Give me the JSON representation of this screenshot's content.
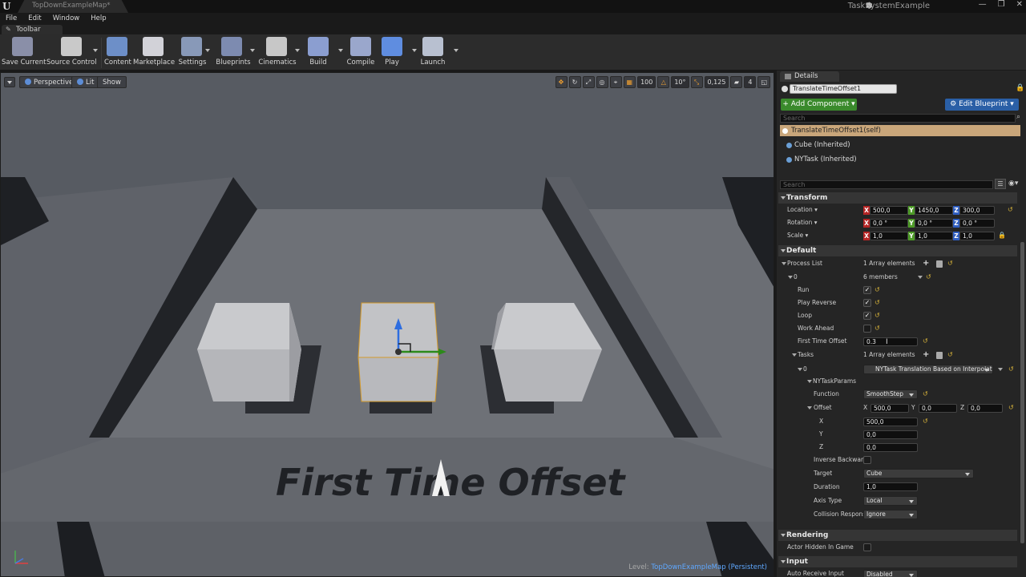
{
  "titlebar": {
    "doc_tab": "TopDownExampleMap*",
    "project": "TaskSystemExample",
    "controls": [
      "—",
      "❐",
      "✕"
    ]
  },
  "menu": [
    "File",
    "Edit",
    "Window",
    "Help"
  ],
  "toolbar_tab": "Toolbar",
  "toolbar": [
    {
      "label": "Save Current",
      "icon": "save-icon",
      "color": "#8a8fa8"
    },
    {
      "label": "Source Control",
      "icon": "source-control-icon",
      "color": "#c9c9c9"
    },
    {
      "label": "Content",
      "icon": "content-icon",
      "color": "#6d8fc8"
    },
    {
      "label": "Marketplace",
      "icon": "marketplace-icon",
      "color": "#d2d2d8"
    },
    {
      "label": "Settings",
      "icon": "settings-icon",
      "color": "#8899b8"
    },
    {
      "label": "Blueprints",
      "icon": "blueprints-icon",
      "color": "#7d8bb0"
    },
    {
      "label": "Cinematics",
      "icon": "cinematics-icon",
      "color": "#c7c7c7"
    },
    {
      "label": "Build",
      "icon": "build-icon",
      "color": "#8b9ed0"
    },
    {
      "label": "Compile",
      "icon": "compile-icon",
      "color": "#9aa7cc"
    },
    {
      "label": "Play",
      "icon": "play-icon",
      "color": "#5f8de0"
    },
    {
      "label": "Launch",
      "icon": "launch-icon",
      "color": "#b8c0d0"
    }
  ],
  "viewport": {
    "perspective": "Perspective",
    "lit": "Lit",
    "show": "Show",
    "grid_snap": "100",
    "rot_snap": "10°",
    "scale_snap": "0,125",
    "cam_speed": "4",
    "level_prefix": "Level:",
    "level_name": "TopDownExampleMap (Persistent)",
    "floor_text": "First Time Offset"
  },
  "details": {
    "tab": "Details",
    "actor_name": "TranslateTimeOffset1",
    "add_component": "+ Add Component ▾",
    "edit_blueprint": "⚙ Edit Blueprint ▾",
    "search_placeholder": "Search",
    "components": [
      {
        "label": "TranslateTimeOffset1(self)",
        "selected": true
      },
      {
        "label": "Cube (Inherited)",
        "selected": false
      },
      {
        "label": "NYTask (Inherited)",
        "selected": false
      }
    ],
    "transform": {
      "header": "Transform",
      "location_label": "Location ▾",
      "rotation_label": "Rotation ▾",
      "scale_label": "Scale ▾",
      "location": [
        "500,0",
        "1450,0",
        "300,0"
      ],
      "rotation": [
        "0,0 °",
        "0,0 °",
        "0,0 °"
      ],
      "scale": [
        "1,0",
        "1,0",
        "1,0"
      ]
    },
    "default": {
      "header": "Default",
      "process_list": "Process List",
      "array_elements": "1 Array elements",
      "index0": "0",
      "members": "6 members",
      "run": "Run",
      "play_reverse": "Play Reverse",
      "loop": "Loop",
      "work_ahead": "Work Ahead",
      "first_time_offset": "First Time Offset",
      "first_time_offset_value": "0.3",
      "tasks": "Tasks",
      "tasks_array": "1 Array elements",
      "task0": "0",
      "task0_value": "NYTask Translation Based on Interpolation",
      "params": "NYTaskParams",
      "function": "Function",
      "function_value": "SmoothStep",
      "offset": "Offset",
      "offset_x": "500,0",
      "offset_y": "0,0",
      "offset_z": "0,0",
      "x": "X",
      "y": "Y",
      "z": "Z",
      "x_val": "500,0",
      "y_val": "0,0",
      "z_val": "0,0",
      "inverse_backward": "Inverse Backward",
      "target": "Target",
      "target_value": "Cube",
      "duration": "Duration",
      "duration_value": "1,0",
      "axis_type": "Axis Type",
      "axis_type_value": "Local",
      "collision_response": "Collision Respons",
      "collision_response_value": "Ignore"
    },
    "rendering": {
      "header": "Rendering",
      "actor_hidden": "Actor Hidden In Game"
    },
    "input": {
      "header": "Input",
      "auto_receive": "Auto Receive Input",
      "auto_receive_value": "Disabled"
    }
  },
  "colors": {
    "accent_green": "#3a8a2c",
    "accent_blue": "#2a5fa6",
    "selection": "#c9a67a",
    "reset_arrow": "#d6b23a"
  }
}
